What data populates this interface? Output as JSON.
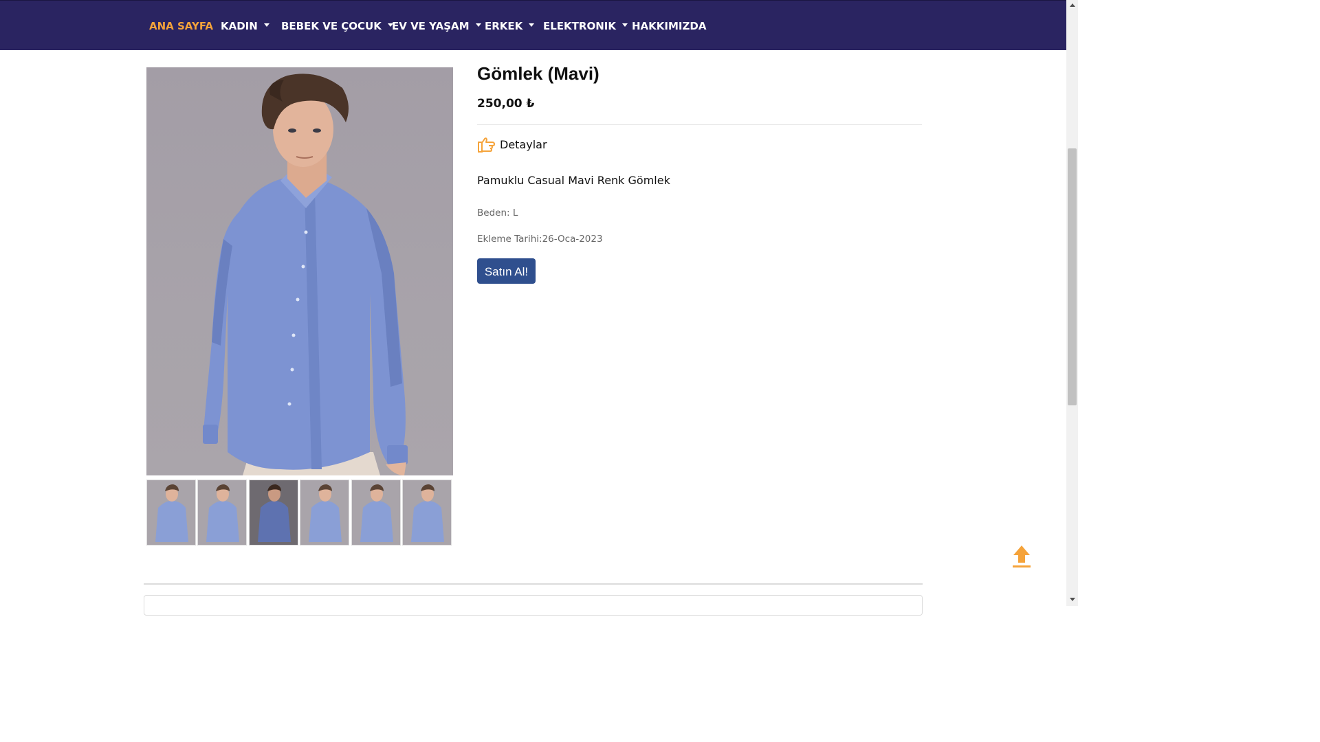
{
  "nav": {
    "items": [
      {
        "label": "ANA SAYFA",
        "active": true,
        "dropdown": false
      },
      {
        "label": "KADIN",
        "active": false,
        "dropdown": true
      },
      {
        "label": "BEBEK VE ÇOCUK",
        "active": false,
        "dropdown": true
      },
      {
        "label": "EV VE YAŞAM",
        "active": false,
        "dropdown": true
      },
      {
        "label": "ERKEK",
        "active": false,
        "dropdown": true
      },
      {
        "label": "ELEKTRONIK",
        "active": false,
        "dropdown": true
      },
      {
        "label": "HAKKIMIZDA",
        "active": false,
        "dropdown": false
      }
    ]
  },
  "product": {
    "title": "Gömlek (Mavi)",
    "price": "250,00 ₺",
    "details_label": "Detaylar",
    "description": "Pamuklu Casual Mavi Renk Gömlek",
    "size": "Beden: L",
    "added_date": "Ekleme Tarihi:26-Oca-2023",
    "buy_label": "Satın Al!",
    "thumbnails": [
      {
        "selected": false
      },
      {
        "selected": false
      },
      {
        "selected": true
      },
      {
        "selected": false
      },
      {
        "selected": false
      },
      {
        "selected": false
      }
    ]
  },
  "icons": {
    "details": "pointing-hand-icon",
    "scroll_top": "arrow-up-icon"
  },
  "colors": {
    "nav_background": "#2a2461",
    "nav_active": "#f5a33a",
    "button": "#2f4f8e",
    "accent_icon": "#f5a33a"
  }
}
